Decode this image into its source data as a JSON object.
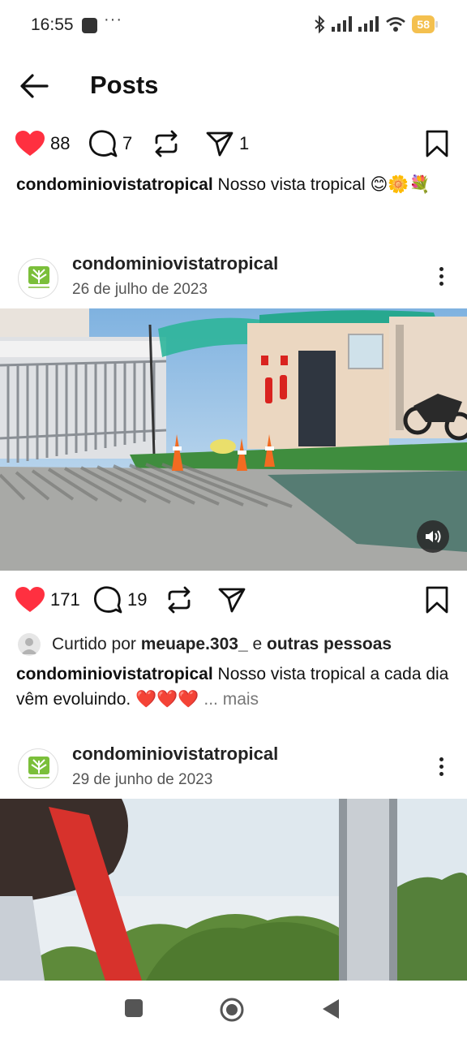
{
  "status_bar": {
    "time": "16:55",
    "battery": "58",
    "icons": [
      "notification-icon",
      "more-dots-icon",
      "bluetooth-icon",
      "signal-icon",
      "signal-icon",
      "wifi-icon",
      "battery-icon"
    ]
  },
  "header": {
    "title": "Posts",
    "back_icon": "arrow-left-icon"
  },
  "post_top": {
    "likes": "88",
    "comments": "7",
    "reposts": "",
    "shares": "1",
    "caption_user": "condominiovistatropical",
    "caption_text": "Nosso vista tropical 😊🌼💐"
  },
  "post_1": {
    "username": "condominiovistatropical",
    "date": "26 de julho de 2023",
    "likes": "171",
    "comments": "19",
    "liked_by_prefix": "Curtido por",
    "liked_by_user": "meuape.303_",
    "liked_by_and": "e",
    "liked_by_others": "outras pessoas",
    "caption_user": "condominiovistatropical",
    "caption_text": "Nosso vista tropical a cada dia vêm evoluindo. ❤️❤️❤️",
    "more_label": "... mais"
  },
  "post_2": {
    "username": "condominiovistatropical",
    "date": "29 de junho de 2023"
  },
  "colors": {
    "like_red": "#ff3040",
    "text": "#111111",
    "muted": "#555555"
  }
}
